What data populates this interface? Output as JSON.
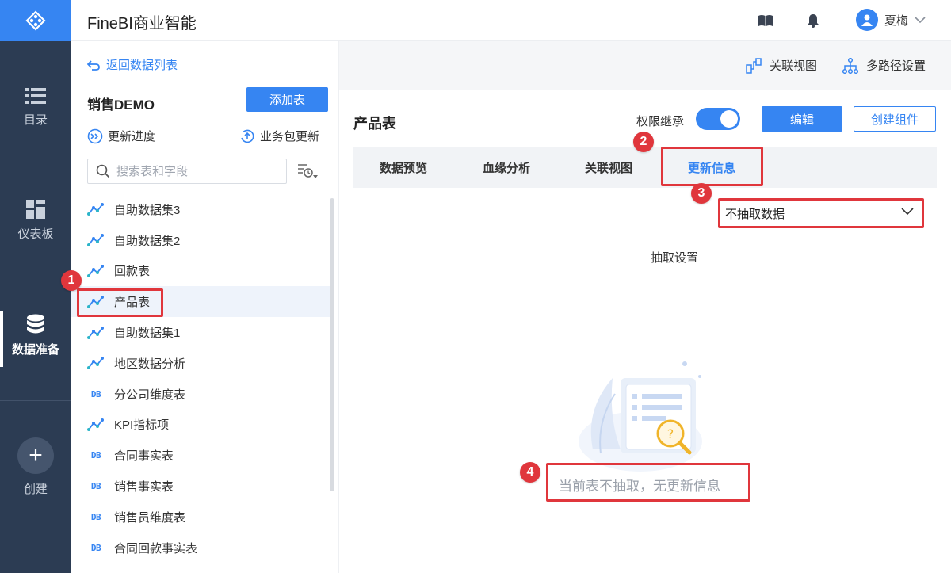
{
  "app": {
    "title": "FineBI商业智能"
  },
  "colors": {
    "accent": "#3685f2",
    "nav_bg": "#2c3c53",
    "annotation": "#e0363c"
  },
  "header": {
    "icons": [
      "book-icon",
      "bell-icon"
    ],
    "user": {
      "name": "夏梅"
    }
  },
  "nav": {
    "items": [
      {
        "label": "目录",
        "icon": "list-icon"
      },
      {
        "label": "仪表板",
        "icon": "dashboard-icon"
      },
      {
        "label": "数据准备",
        "icon": "database-icon",
        "active": true
      },
      {
        "label": "创建",
        "icon": "plus-icon"
      }
    ]
  },
  "left": {
    "back_label": "返回数据列表",
    "package_title": "销售DEMO",
    "add_table_label": "添加表",
    "update_progress_label": "更新进度",
    "package_update_label": "业务包更新",
    "search_placeholder": "搜索表和字段",
    "tables": [
      {
        "label": "自助数据集3",
        "icon": "self-dataset-icon"
      },
      {
        "label": "自助数据集2",
        "icon": "self-dataset-icon"
      },
      {
        "label": "回款表",
        "icon": "self-dataset-icon"
      },
      {
        "label": "产品表",
        "icon": "self-dataset-icon",
        "selected": true
      },
      {
        "label": "自助数据集1",
        "icon": "self-dataset-icon"
      },
      {
        "label": "地区数据分析",
        "icon": "self-dataset-icon"
      },
      {
        "label": "分公司维度表",
        "icon": "db-icon"
      },
      {
        "label": "KPI指标项",
        "icon": "self-dataset-icon"
      },
      {
        "label": "合同事实表",
        "icon": "db-icon"
      },
      {
        "label": "销售事实表",
        "icon": "db-icon"
      },
      {
        "label": "销售员维度表",
        "icon": "db-icon"
      },
      {
        "label": "合同回款事实表",
        "icon": "db-icon"
      }
    ],
    "db_icon_text": "DB"
  },
  "right": {
    "relation_view_label": "关联视图",
    "multipath_label": "多路径设置",
    "table_title": "产品表",
    "permission_label": "权限继承",
    "permission_on": true,
    "edit_label": "编辑",
    "create_component_label": "创建组件",
    "tabs": [
      {
        "label": "数据预览"
      },
      {
        "label": "血缘分析"
      },
      {
        "label": "关联视图"
      },
      {
        "label": "更新信息",
        "active": true
      }
    ],
    "extract_label": "抽取设置",
    "extract_value": "不抽取数据",
    "empty_message": "当前表不抽取，无更新信息"
  },
  "annotations": [
    "1",
    "2",
    "3",
    "4"
  ]
}
